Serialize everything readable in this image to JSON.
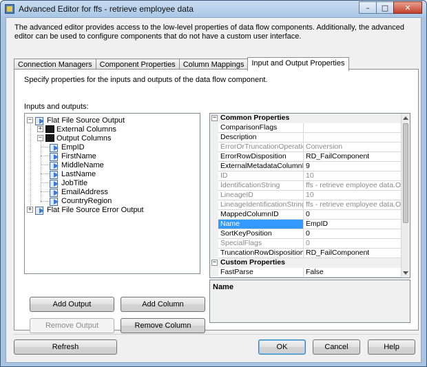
{
  "window": {
    "title": "Advanced Editor for ffs - retrieve employee data",
    "minimize": "–",
    "maximize": "□",
    "close": "✕"
  },
  "description": "The advanced editor provides access to the low-level properties of data flow components. Additionally, the advanced editor can be used to configure components that do not have a custom user interface.",
  "tabs": [
    {
      "label": "Connection Managers"
    },
    {
      "label": "Component Properties"
    },
    {
      "label": "Column Mappings"
    },
    {
      "label": "Input and Output Properties",
      "active": true
    }
  ],
  "page": {
    "subtitle": "Specify properties for the inputs and outputs of the data flow component.",
    "io_label": "Inputs and outputs:"
  },
  "tree": {
    "nodes": [
      {
        "label": "Flat File Source Output",
        "expander": "−",
        "icon": "output-icon"
      },
      {
        "label": "External Columns",
        "expander": "+",
        "icon": "folder-icon"
      },
      {
        "label": "Output Columns",
        "expander": "−",
        "icon": "folder-icon"
      },
      {
        "label": "EmpID",
        "icon": "column-icon"
      },
      {
        "label": "FirstName",
        "icon": "column-icon"
      },
      {
        "label": "MiddleName",
        "icon": "column-icon"
      },
      {
        "label": "LastName",
        "icon": "column-icon"
      },
      {
        "label": "JobTitle",
        "icon": "column-icon"
      },
      {
        "label": "EmailAddress",
        "icon": "column-icon"
      },
      {
        "label": "CountryRegion",
        "icon": "column-icon"
      },
      {
        "label": "Flat File Source Error Output",
        "expander": "+",
        "icon": "output-icon"
      }
    ]
  },
  "buttons": {
    "add_output": "Add Output",
    "add_column": "Add Column",
    "remove_output": "Remove Output",
    "remove_column": "Remove Column",
    "refresh": "Refresh",
    "ok": "OK",
    "cancel": "Cancel",
    "help": "Help"
  },
  "properties": {
    "common_category": "Common Properties",
    "custom_category": "Custom Properties",
    "category_expander": "−",
    "rows": [
      {
        "name": "ComparisonFlags",
        "value": ""
      },
      {
        "name": "Description",
        "value": ""
      },
      {
        "name": "ErrorOrTruncationOperation",
        "value": "Conversion",
        "readonly": true
      },
      {
        "name": "ErrorRowDisposition",
        "value": "RD_FailComponent"
      },
      {
        "name": "ExternalMetadataColumnID",
        "value": "9"
      },
      {
        "name": "ID",
        "value": "10",
        "readonly": true
      },
      {
        "name": "IdentificationString",
        "value": "ffs - retrieve employee data.Output",
        "readonly": true
      },
      {
        "name": "LineageID",
        "value": "10",
        "readonly": true
      },
      {
        "name": "LineageIdentificationString",
        "value": "ffs - retrieve employee data.Output",
        "readonly": true
      },
      {
        "name": "MappedColumnID",
        "value": "0"
      },
      {
        "name": "Name",
        "value": "EmpID",
        "selected": true
      },
      {
        "name": "SortKeyPosition",
        "value": "0"
      },
      {
        "name": "SpecialFlags",
        "value": "0",
        "readonly": true
      },
      {
        "name": "TruncationRowDisposition",
        "value": "RD_FailComponent"
      }
    ],
    "custom_rows": [
      {
        "name": "FastParse",
        "value": "False"
      }
    ],
    "description_title": "Name"
  }
}
